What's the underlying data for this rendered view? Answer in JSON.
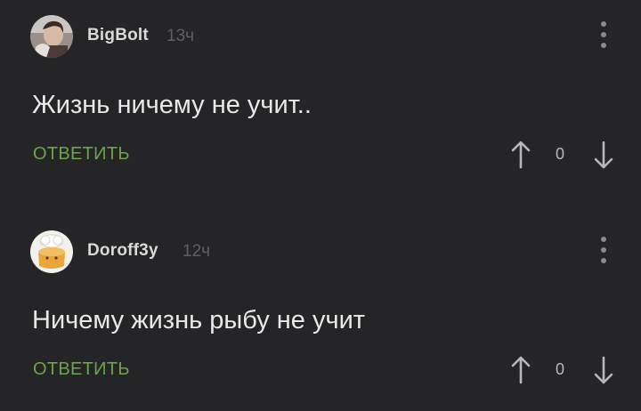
{
  "comments": [
    {
      "username": "BigBolt",
      "time": "13ч",
      "text": "Жизнь ничему не учит..",
      "reply_label": "ОТВЕТИТЬ",
      "score": "0",
      "avatar_icon": "user-photo-avatar",
      "menu_icon": "more-vertical-icon"
    },
    {
      "username": "Doroff3y",
      "time": "12ч",
      "text": "Ничему жизнь рыбу не учит",
      "reply_label": "ОТВЕТИТЬ",
      "score": "0",
      "avatar_icon": "cartoon-avatar",
      "menu_icon": "more-vertical-icon"
    }
  ],
  "colors": {
    "background": "#252527",
    "reply": "#6ca448",
    "username": "#d9d9d9",
    "time": "#5f5f63",
    "text": "#e8e8e8"
  }
}
